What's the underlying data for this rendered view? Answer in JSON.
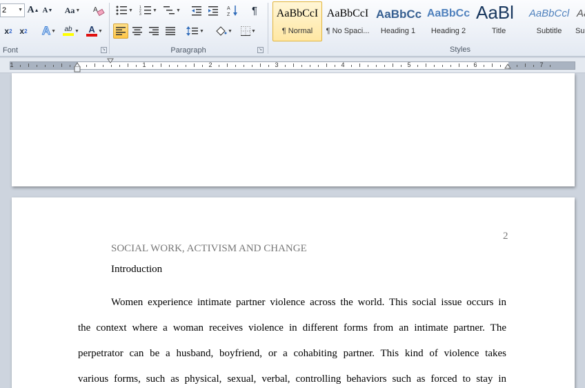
{
  "ribbon": {
    "font_group": {
      "label": "Font",
      "font_size": "2",
      "grow_font": "A",
      "shrink_font": "A",
      "change_case": "Aa",
      "subscript": "x",
      "superscript": "x",
      "text_effects": "A",
      "highlight": "ab",
      "font_color": "A",
      "highlight_color": "#ffff00",
      "font_color_value": "#e01010"
    },
    "paragraph_group": {
      "label": "Paragraph",
      "show_marks": "¶",
      "align_selected": "left"
    },
    "styles_group": {
      "label": "Styles",
      "styles": [
        {
          "sample": "AaBbCcI",
          "name": "¶ Normal",
          "selected": true
        },
        {
          "sample": "AaBbCcI",
          "name": "¶ No Spaci...",
          "selected": false
        },
        {
          "sample": "AaBbCc",
          "name": "Heading 1",
          "selected": false
        },
        {
          "sample": "AaBbCc",
          "name": "Heading 2",
          "selected": false
        },
        {
          "sample": "AaBl",
          "name": "Title",
          "selected": false
        },
        {
          "sample": "AaBbCcl",
          "name": "Subtitle",
          "selected": false
        },
        {
          "sample": "Aa",
          "name": "Sub",
          "selected": false
        }
      ]
    }
  },
  "ruler": {
    "numbers": [
      "1",
      "1",
      "2",
      "3",
      "4",
      "5",
      "6",
      "7"
    ]
  },
  "document": {
    "page2": {
      "page_number": "2",
      "running_head": "SOCIAL WORK, ACTIVISM AND CHANGE",
      "heading": "Introduction",
      "lines": [
        "Women experience intimate partner violence across the world. This social issue occurs in",
        "the context where a woman receives violence in different forms from an intimate partner. The",
        "perpetrator can be a husband, boyfriend, or a cohabiting partner. This kind of violence takes",
        "various forms, such as physical, sexual, verbal, controlling behaviors such as forced to stay in"
      ]
    }
  },
  "colors": {
    "ribbon_bg": "#e3e9f2",
    "selected_style": "#ffe7a3",
    "heading_blue": "#365f91",
    "app_bg": "#cdd4de"
  }
}
